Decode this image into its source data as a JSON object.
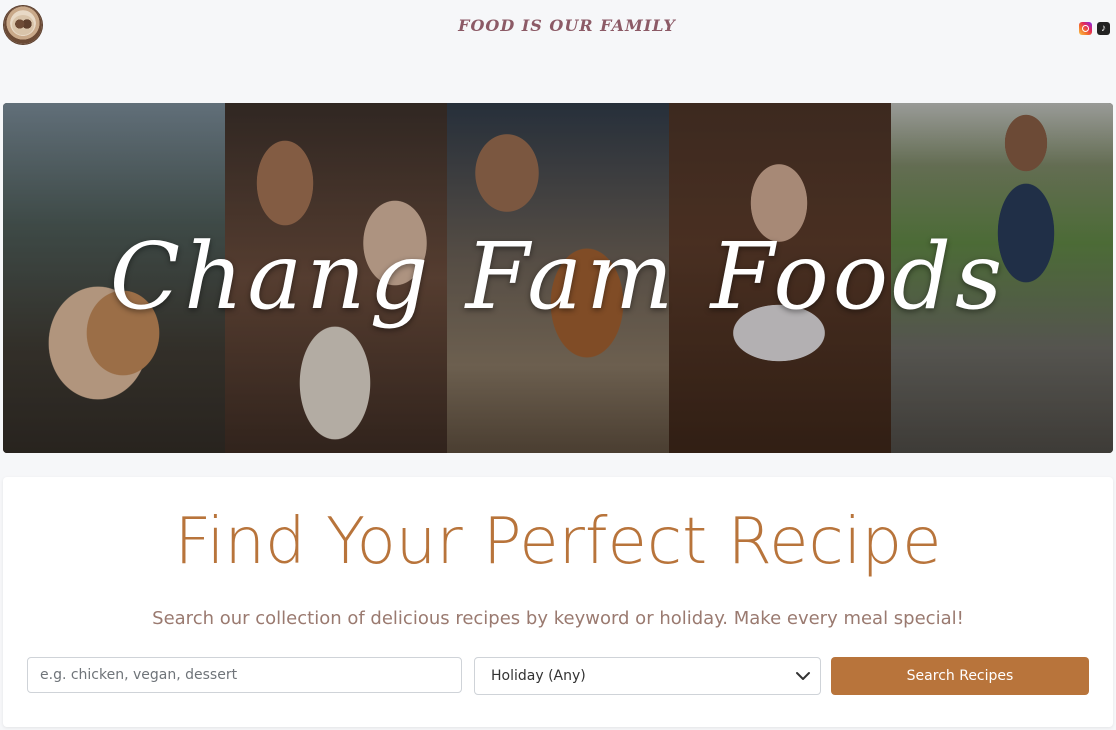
{
  "header": {
    "tagline": "FOOD IS OUR FAMILY",
    "logo_icon": "chang-fam-logo-icon",
    "social": [
      {
        "name": "instagram-icon",
        "color": "#e0245e"
      },
      {
        "name": "tiktok-icon",
        "color": "#222222"
      }
    ]
  },
  "hero": {
    "title": "Chang Fam Foods"
  },
  "search": {
    "title": "Find Your Perfect Recipe",
    "subtitle": "Search our collection of delicious recipes by keyword or holiday. Make every meal special!",
    "keyword_placeholder": "e.g. chicken, vegan, dessert",
    "keyword_value": "",
    "holiday_selected": "Holiday (Any)",
    "button_label": "Search Recipes"
  },
  "colors": {
    "accent": "#b8743b",
    "tagline": "#8c5a66",
    "background": "#f6f7f9"
  }
}
